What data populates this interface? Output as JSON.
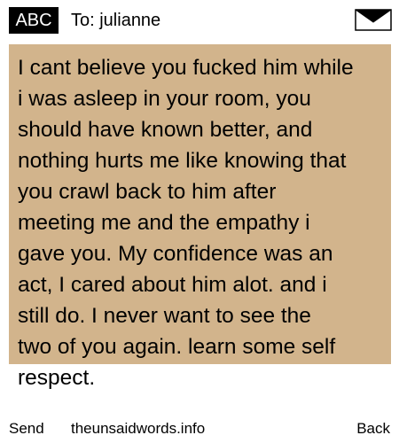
{
  "header": {
    "badge_label": "ABC",
    "to_label": "To: julianne",
    "icon": "envelope-icon"
  },
  "message": {
    "background": "#d2b48c",
    "text": "I cant believe you fucked him while\ni was asleep in your room, you\nshould have known better, and\nnothing hurts me like knowing that\nyou crawl back to him after\nmeeting me and the empathy i\ngave you. My confidence was an\nact, I cared about him alot. and i\nstill do.  I never want to see the\ntwo of you again. learn some self\nrespect."
  },
  "footer": {
    "send_label": "Send",
    "site_label": "theunsaidwords.info",
    "back_label": "Back"
  }
}
